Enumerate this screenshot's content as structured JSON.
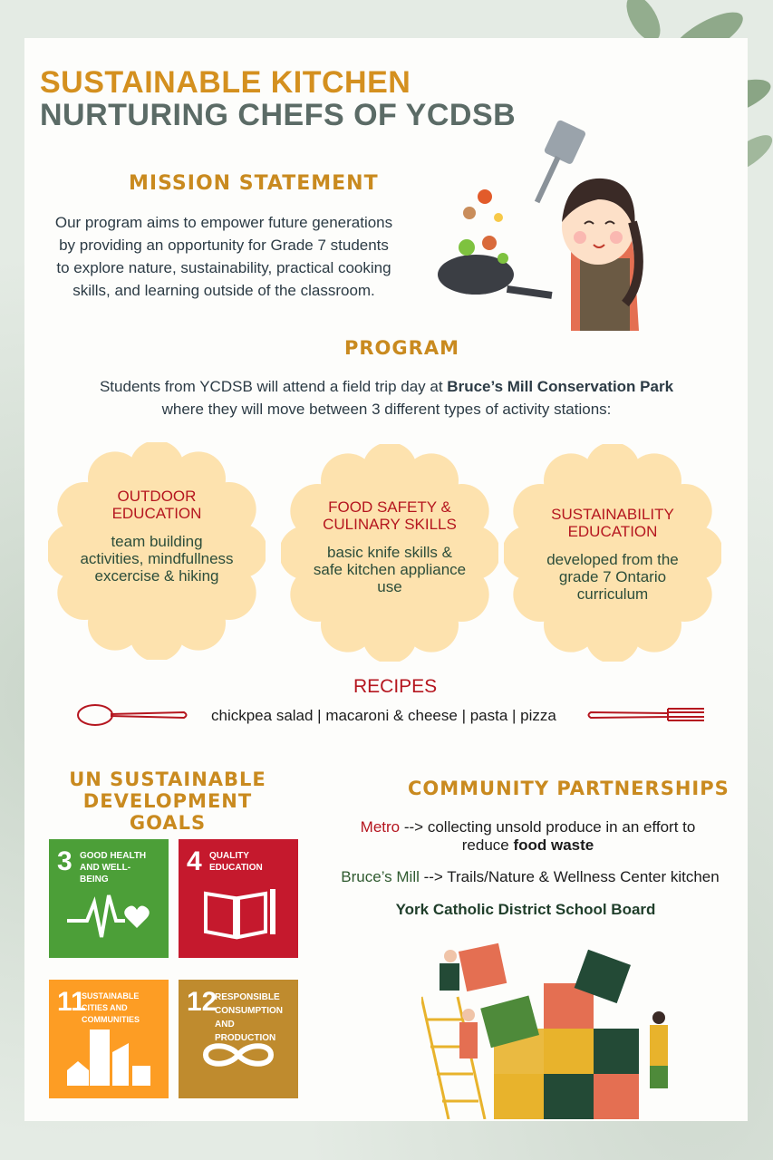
{
  "title": {
    "line1": "SUSTAINABLE KITCHEN",
    "line2": "NURTURING CHEFS OF YCDSB"
  },
  "mission": {
    "heading": "Mission Statement",
    "text": "Our program aims to empower future generations by providing an opportunity for Grade 7 students to explore nature, sustainability, practical cooking skills, and learning outside of the classroom."
  },
  "program": {
    "heading": "Program",
    "text_before": "Students from YCDSB will attend a field trip day at ",
    "text_bold": "Bruce’s Mill Conservation Park",
    "text_after": "where they will move between 3 different types of activity stations:"
  },
  "stations": [
    {
      "title": "OUTDOOR EDUCATION",
      "desc": "team building activities, mindfullness excercise & hiking"
    },
    {
      "title": "FOOD SAFETY & CULINARY SKILLS",
      "desc": "basic knife skills & safe kitchen appliance use"
    },
    {
      "title": "SUSTAINABILITY EDUCATION",
      "desc": "developed from the grade 7 Ontario curriculum"
    }
  ],
  "recipes": {
    "heading": "RECIPES",
    "list": "chickpea salad | macaroni & cheese | pasta | pizza"
  },
  "sdg": {
    "heading_line1": "UN Sustainable",
    "heading_line2": "Development Goals",
    "goals": [
      {
        "number": "3",
        "label": "GOOD HEALTH AND WELL-BEING",
        "color": "#4c9f38"
      },
      {
        "number": "4",
        "label": "QUALITY EDUCATION",
        "color": "#c5192d"
      },
      {
        "number": "11",
        "label": "SUSTAINABLE CITIES AND COMMUNITIES",
        "color": "#fd9d24"
      },
      {
        "number": "12",
        "label": "RESPONSIBLE CONSUMPTION AND PRODUCTION",
        "color": "#bf8b2e"
      }
    ]
  },
  "partnerships": {
    "heading": "Community Partnerships",
    "metro_name": "Metro",
    "metro_text": " --> collecting unsold produce in an effort to",
    "metro_text2": "reduce ",
    "metro_bold": "food waste",
    "bruces_name": "Bruce’s Mill",
    "bruces_text": " --> Trails/Nature & Wellness Center kitchen",
    "board": "York Catholic District School Board"
  },
  "colors": {
    "gold": "#d4901f",
    "slate": "#5b6b66",
    "red": "#b5161f",
    "flower": "#fde2ae",
    "green": "#2f5a2f"
  }
}
